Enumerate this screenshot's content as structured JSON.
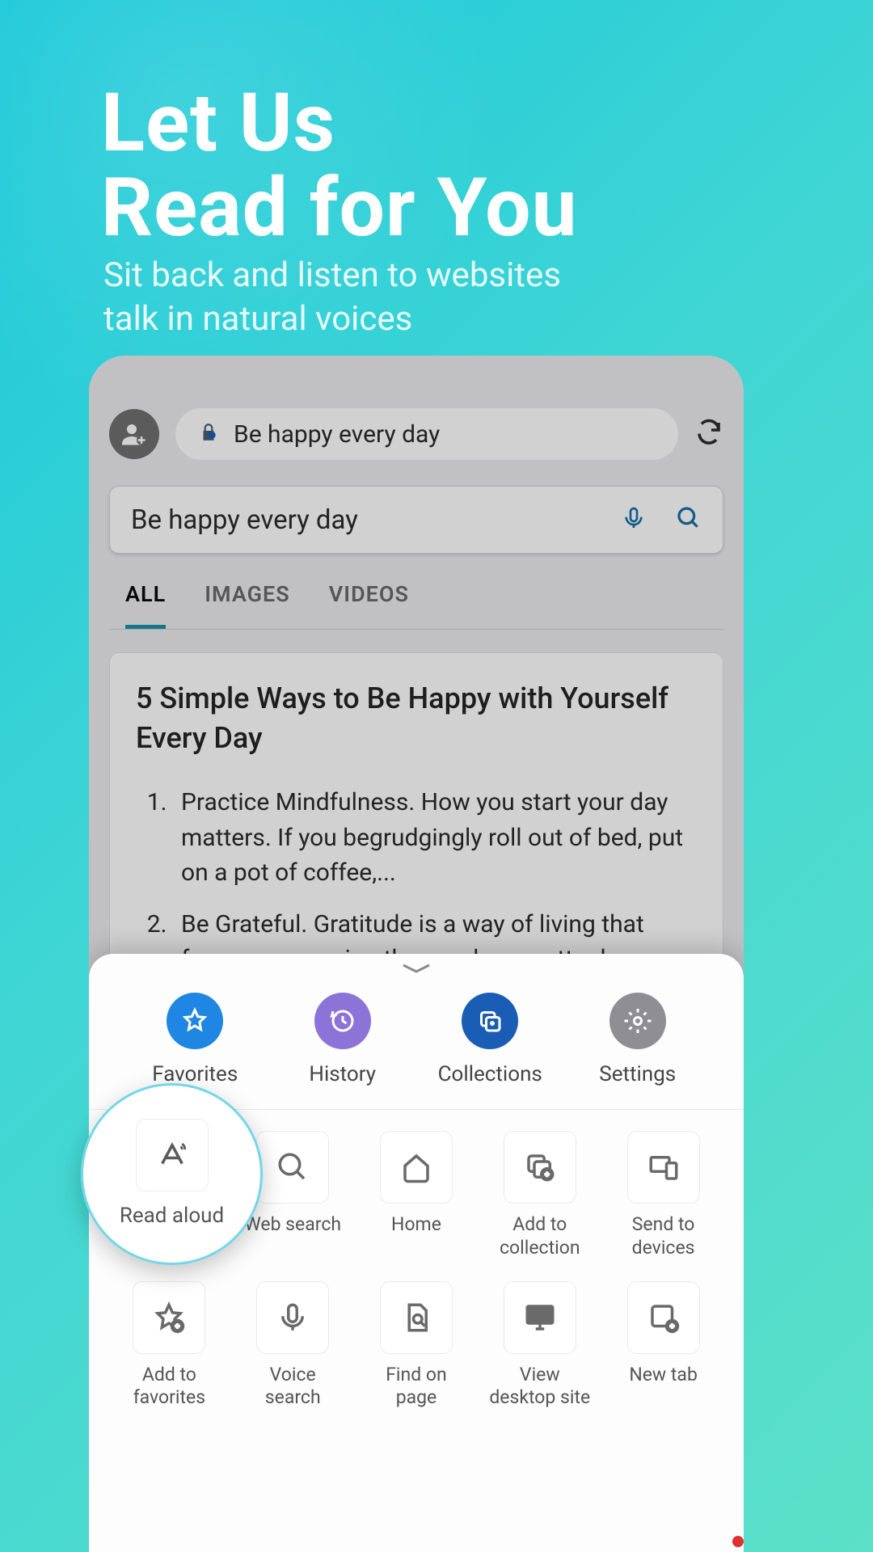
{
  "promo": {
    "title_line1": "Let Us",
    "title_line2": "Read for You",
    "subtitle_line1": "Sit back and listen to websites",
    "subtitle_line2": "talk in natural voices"
  },
  "browser": {
    "url_text": "Be happy every day",
    "search_text": "Be happy every day",
    "tabs": {
      "all": "ALL",
      "images": "IMAGES",
      "videos": "VIDEOS"
    },
    "result": {
      "title": "5 Simple Ways to Be Happy with Yourself Every Day",
      "item1": "Practice Mindfulness. How you start your day matters. If you begrudgingly roll out of bed, put on a pot of coffee,...",
      "item2": "Be Grateful. Gratitude is a way of living that focuses on seeing the good, no matter how"
    }
  },
  "sheet": {
    "top": {
      "favorites": "Favorites",
      "history": "History",
      "collections": "Collections",
      "settings": "Settings"
    },
    "actions": {
      "read_aloud": "Read aloud",
      "web_search": "Web search",
      "home": "Home",
      "add_collection": "Add to collection",
      "send_devices": "Send to devices",
      "add_favorites": "Add to favorites",
      "voice_search": "Voice search",
      "find_on_page": "Find on page",
      "view_desktop": "View desktop site",
      "new_tab": "New tab"
    }
  }
}
